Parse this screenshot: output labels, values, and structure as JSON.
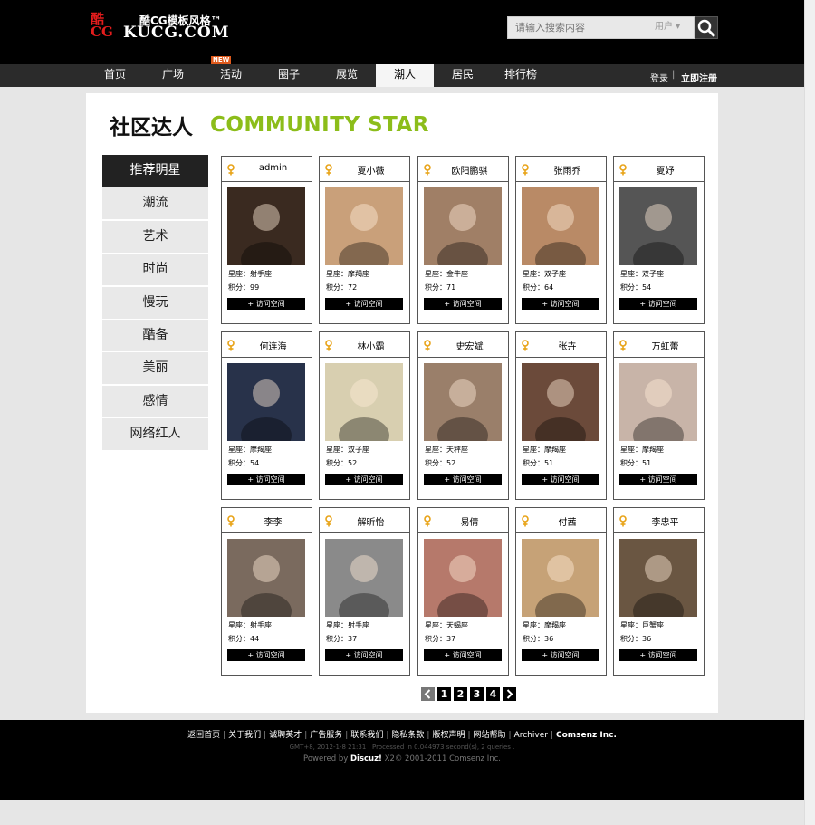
{
  "header": {
    "logo_mark_top": "酷",
    "logo_mark_bottom": "CG",
    "logo_cn": "酷CG模板风格™",
    "logo_en": "KUCG.COM",
    "search_placeholder": "请输入搜索内容",
    "search_type": "用户 ▾"
  },
  "nav": {
    "items": [
      "首页",
      "广场",
      "活动",
      "圈子",
      "展览",
      "潮人",
      "居民",
      "排行榜"
    ],
    "active": "潮人",
    "new_badge": "NEW",
    "login": "登录",
    "separator": "|",
    "register": "立即注册"
  },
  "heading": {
    "cn": "社区达人",
    "en": "COMMUNITY STAR",
    "en_color": "#8cbd1a"
  },
  "sidebar": {
    "items": [
      "推荐明星",
      "潮流",
      "艺术",
      "时尚",
      "慢玩",
      "酷备",
      "美丽",
      "感情",
      "网络红人"
    ],
    "active": "推荐明星"
  },
  "cards": [
    {
      "name": "admin",
      "sign": "星座：射手座",
      "score": "积分：99",
      "visit": "+ 访问空间",
      "photo": "#3a2a20"
    },
    {
      "name": "夏小薇",
      "sign": "星座：摩羯座",
      "score": "积分：72",
      "visit": "+ 访问空间",
      "photo": "#c9a07a"
    },
    {
      "name": "欧阳鹏骐",
      "sign": "星座：金牛座",
      "score": "积分：71",
      "visit": "+ 访问空间",
      "photo": "#a07f66"
    },
    {
      "name": "张雨乔",
      "sign": "星座：双子座",
      "score": "积分：64",
      "visit": "+ 访问空间",
      "photo": "#b98a66"
    },
    {
      "name": "夏妤",
      "sign": "星座：双子座",
      "score": "积分：54",
      "visit": "+ 访问空间",
      "photo": "#555555"
    },
    {
      "name": "何连海",
      "sign": "星座：摩羯座",
      "score": "积分：54",
      "visit": "+ 访问空间",
      "photo": "#28324a"
    },
    {
      "name": "林小霸",
      "sign": "星座：双子座",
      "score": "积分：52",
      "visit": "+ 访问空间",
      "photo": "#d8cfb0"
    },
    {
      "name": "史宏斌",
      "sign": "星座：天秤座",
      "score": "积分：52",
      "visit": "+ 访问空间",
      "photo": "#9a7f6a"
    },
    {
      "name": "张卉",
      "sign": "星座：摩羯座",
      "score": "积分：51",
      "visit": "+ 访问空间",
      "photo": "#6b4a3a"
    },
    {
      "name": "万虹蕾",
      "sign": "星座：摩羯座",
      "score": "积分：51",
      "visit": "+ 访问空间",
      "photo": "#c8b4a8"
    },
    {
      "name": "李李",
      "sign": "星座：射手座",
      "score": "积分：44",
      "visit": "+ 访问空间",
      "photo": "#7a6a5e"
    },
    {
      "name": "解昕怡",
      "sign": "星座：射手座",
      "score": "积分：37",
      "visit": "+ 访问空间",
      "photo": "#8a8a8a"
    },
    {
      "name": "易倩",
      "sign": "星座：天蝎座",
      "score": "积分：37",
      "visit": "+ 访问空间",
      "photo": "#b6796b"
    },
    {
      "name": "付茜",
      "sign": "星座：摩羯座",
      "score": "积分：36",
      "visit": "+ 访问空间",
      "photo": "#c6a277"
    },
    {
      "name": "李忠平",
      "sign": "星座：巨蟹座",
      "score": "积分：36",
      "visit": "+ 访问空间",
      "photo": "#6a5642"
    }
  ],
  "pagination": {
    "pages": [
      "1",
      "2",
      "3",
      "4"
    ]
  },
  "footer": {
    "links": [
      "返回首页",
      "关于我们",
      "诚聘英才",
      "广告服务",
      "联系我们",
      "隐私条款",
      "版权声明",
      "网站帮助",
      "Archiver",
      "Comsenz Inc."
    ],
    "time": "GMT+8, 2012-1-8 21:31 , Processed in 0.044973 second(s), 2 queries .",
    "powered_prefix": "Powered by",
    "powered_brand": "Discuz!",
    "powered_suffix": "X2© 2001-2011 Comsenz Inc."
  }
}
